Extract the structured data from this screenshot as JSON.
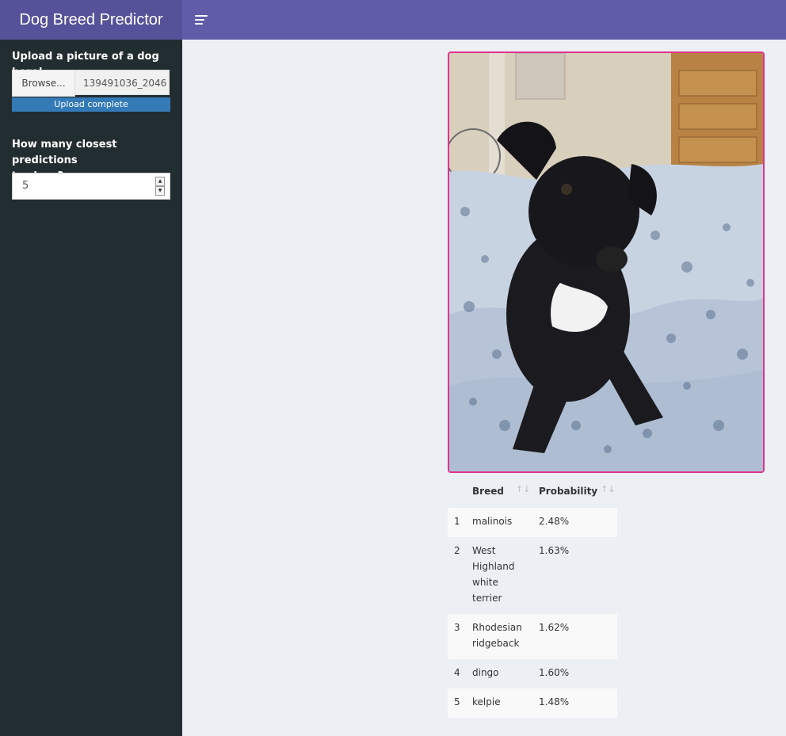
{
  "app": {
    "title": "Dog Breed Predictor"
  },
  "sidebar": {
    "upload_label": "Upload a picture of a dog here!",
    "browse_label": "Browse...",
    "file_name": "139491036_2046",
    "upload_status": "Upload complete",
    "count_label_line1": "How many closest predictions",
    "count_label_line2": "to show?",
    "count_value": "5"
  },
  "table": {
    "headers": {
      "breed": "Breed",
      "probability": "Probability"
    },
    "rows": [
      {
        "idx": "1",
        "breed": "malinois",
        "prob": "2.48%"
      },
      {
        "idx": "2",
        "breed": "West Highland white terrier",
        "prob": "1.63%"
      },
      {
        "idx": "3",
        "breed": "Rhodesian ridgeback",
        "prob": "1.62%"
      },
      {
        "idx": "4",
        "breed": "dingo",
        "prob": "1.60%"
      },
      {
        "idx": "5",
        "breed": "kelpie",
        "prob": "1.48%"
      }
    ]
  },
  "colors": {
    "header": "#605ca8",
    "logo": "#555299",
    "sidebar": "#222d32",
    "image_border": "#e0338e",
    "progress": "#337ab7"
  }
}
